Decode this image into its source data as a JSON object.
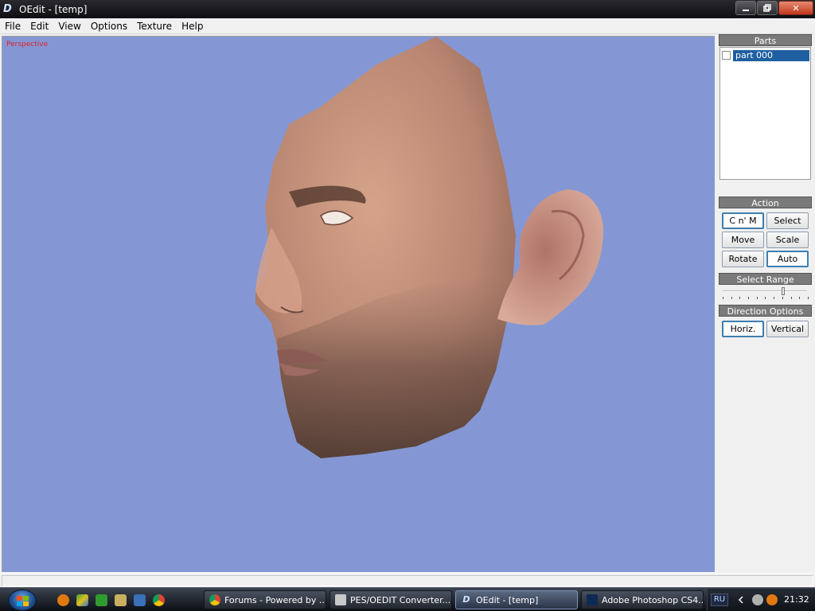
{
  "window": {
    "title": "OEdit - [temp]",
    "app_icon_letter": "D",
    "minimize_icon": "minimize-icon",
    "maximize_icon": "restore-icon",
    "close_glyph": "✕"
  },
  "menu": [
    "File",
    "Edit",
    "View",
    "Options",
    "Texture",
    "Help"
  ],
  "viewport": {
    "label": "Perspective",
    "background": "#8497d4",
    "label_color": "#e0202a"
  },
  "panel": {
    "parts_header": "Parts",
    "parts": [
      {
        "label": "part 000",
        "checked": false,
        "selected": true
      }
    ],
    "action_header": "Action",
    "actions": [
      {
        "label": "C n' M",
        "pressed": true
      },
      {
        "label": "Select",
        "pressed": false
      },
      {
        "label": "Move",
        "pressed": false
      },
      {
        "label": "Scale",
        "pressed": false
      },
      {
        "label": "Rotate",
        "pressed": false
      },
      {
        "label": "Auto",
        "pressed": true
      }
    ],
    "select_range_header": "Select Range",
    "select_range_level": 0.72,
    "direction_header": "Direction Options",
    "directions": [
      {
        "label": "Horiz.",
        "pressed": true
      },
      {
        "label": "Vertical",
        "pressed": false
      }
    ]
  },
  "taskbar": {
    "quick_launch": [
      "avast-icon",
      "drive-icon",
      "utorrent-icon",
      "winamp-icon",
      "desktop-icon",
      "chrome-icon"
    ],
    "tasks": [
      {
        "label": "Forums - Powered by ...",
        "icon": "chrome-icon",
        "active": false
      },
      {
        "label": "PES/OEDIT Converter...",
        "icon": "converter-icon",
        "active": false
      },
      {
        "label": "OEdit - [temp]",
        "icon": "oedit-icon",
        "active": true
      },
      {
        "label": "Adobe Photoshop CS4...",
        "icon": "photoshop-icon",
        "active": false
      }
    ],
    "language": "RU",
    "clock": "21:32"
  }
}
